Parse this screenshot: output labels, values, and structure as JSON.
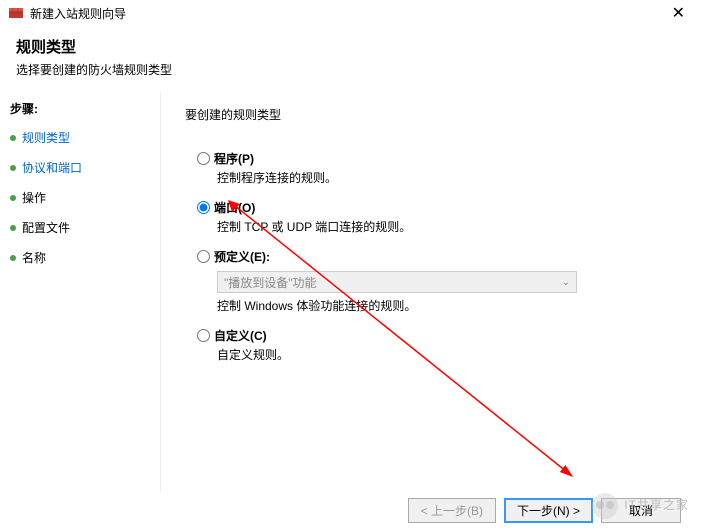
{
  "window": {
    "title": "新建入站规则向导"
  },
  "header": {
    "title": "规则类型",
    "subtitle": "选择要创建的防火墙规则类型"
  },
  "sidebar": {
    "heading": "步骤:",
    "steps": [
      {
        "label": "规则类型",
        "link": true
      },
      {
        "label": "协议和端口",
        "link": true
      },
      {
        "label": "操作",
        "link": false
      },
      {
        "label": "配置文件",
        "link": false
      },
      {
        "label": "名称",
        "link": false
      }
    ]
  },
  "content": {
    "heading": "要创建的规则类型",
    "options": {
      "program": {
        "label": "程序(P)",
        "desc": "控制程序连接的规则。"
      },
      "port": {
        "label": "端口(O)",
        "desc": "控制 TCP 或 UDP 端口连接的规则。"
      },
      "predefined": {
        "label": "预定义(E):",
        "dropdown": "\"播放到设备\"功能",
        "desc": "控制 Windows 体验功能连接的规则。"
      },
      "custom": {
        "label": "自定义(C)",
        "desc": "自定义规则。"
      }
    },
    "selected": "port"
  },
  "footer": {
    "back": "< 上一步(B)",
    "next": "下一步(N) >",
    "cancel": "取消"
  },
  "watermark": "IT共享之家"
}
